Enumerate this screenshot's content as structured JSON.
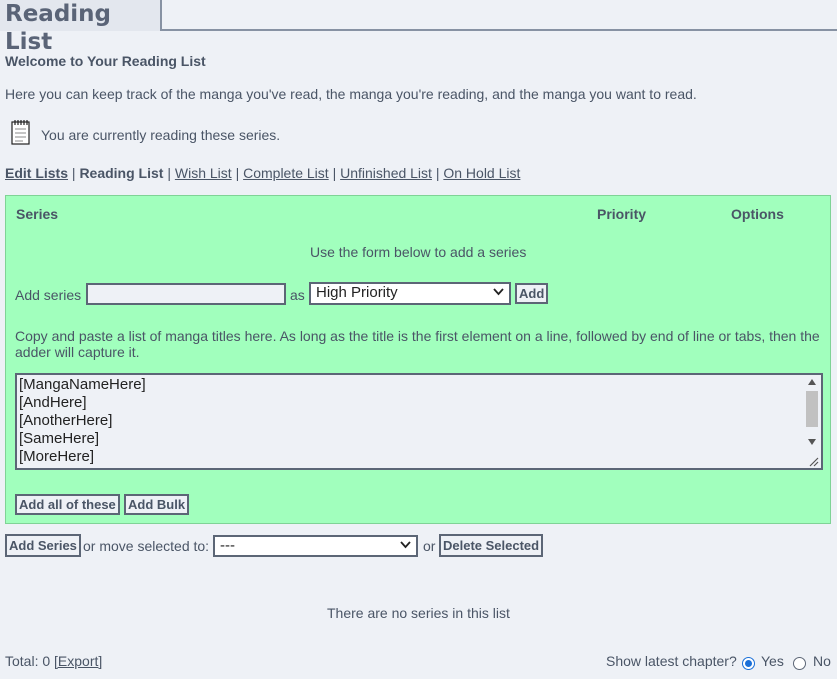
{
  "page": {
    "title": "Reading List",
    "welcome": "Welcome to Your Reading List",
    "intro": "Here you can keep track of the manga you've read, the manga you're reading, and the manga you want to read.",
    "current_notice": "You are currently reading these series."
  },
  "nav": {
    "edit_lists": "Edit Lists",
    "sep": "|",
    "reading_list": "Reading List",
    "wish_list": "Wish List",
    "complete_list": "Complete List",
    "unfinished_list": "Unfinished List",
    "on_hold_list": "On Hold List"
  },
  "table": {
    "col_series": "Series",
    "col_priority": "Priority",
    "col_options": "Options",
    "form_hint": "Use the form below to add a series"
  },
  "add_form": {
    "label": "Add series",
    "input_value": "",
    "as_label": "as",
    "priority_selected": "High Priority",
    "add_button": "Add"
  },
  "bulk": {
    "instructions": "Copy and paste a list of manga titles here. As long as the title is the first element on a line, followed by end of line or tabs, then the adder will capture it.",
    "lines": [
      "[MangaNameHere]",
      "[AndHere]",
      "[AnotherHere]",
      "[SameHere]",
      "[MoreHere]"
    ],
    "add_all_button": "Add all of these",
    "add_bulk_button": "Add Bulk"
  },
  "actions": {
    "add_series_button": "Add Series",
    "move_label": "or move selected to:",
    "move_selected": "---",
    "or_label": "or",
    "delete_button": "Delete Selected"
  },
  "list": {
    "empty_message": "There are no series in this list"
  },
  "footer": {
    "total_label": "Total: 0",
    "export_link": "[Export]",
    "latest_label": "Show latest chapter?",
    "yes_label": "Yes",
    "no_label": "No",
    "latest_value": "Yes"
  },
  "colors": {
    "panel_bg": "#a1ffbd",
    "page_bg": "#eef1f6",
    "text": "#4a5566",
    "radio_accent": "#1a6fd8"
  }
}
